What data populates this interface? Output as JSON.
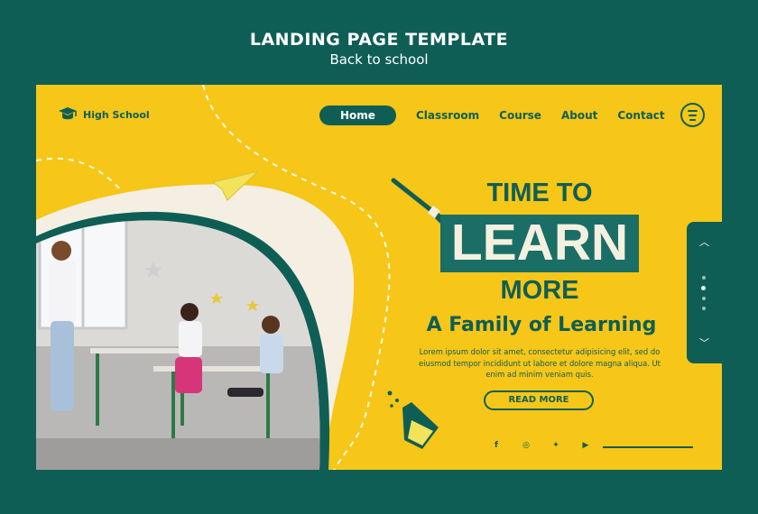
{
  "banner": {
    "title": "LANDING PAGE TEMPLATE",
    "subtitle": "Back to school"
  },
  "brand": {
    "logo_text": "High School",
    "logo_icon": "graduation-cap-icon"
  },
  "nav": {
    "items": [
      {
        "label": "Home",
        "active": true
      },
      {
        "label": "Classroom",
        "active": false
      },
      {
        "label": "Course",
        "active": false
      },
      {
        "label": "About",
        "active": false
      },
      {
        "label": "Contact",
        "active": false
      }
    ],
    "menu_icon": "hamburger-menu-icon"
  },
  "hero": {
    "line1": "TIME TO",
    "line2": "LEARN",
    "line3": "MORE",
    "tagline": "A Family of Learning",
    "body": "Lorem ipsum dolor sit amet, consectetur adipisicing elit, sed do eiusmod tempor incididunt ut labore et dolore magna aliqua. Ut enim ad minim veniam quis.",
    "cta_label": "READ MORE"
  },
  "socials": [
    {
      "icon": "facebook-icon",
      "glyph": "f"
    },
    {
      "icon": "instagram-icon",
      "glyph": "◎"
    },
    {
      "icon": "twitter-icon",
      "glyph": "✦"
    },
    {
      "icon": "youtube-icon",
      "glyph": "▶"
    }
  ],
  "pager": {
    "up_icon": "chevron-up-icon",
    "down_icon": "chevron-down-icon",
    "dots": 4,
    "active_dot": 2
  },
  "colors": {
    "background": "#0f5e56",
    "page_yellow": "#f6c618",
    "accent_teal": "#0f5e56",
    "cream": "#f4f0e0"
  },
  "photo": {
    "description_icon": "classroom-photo"
  }
}
